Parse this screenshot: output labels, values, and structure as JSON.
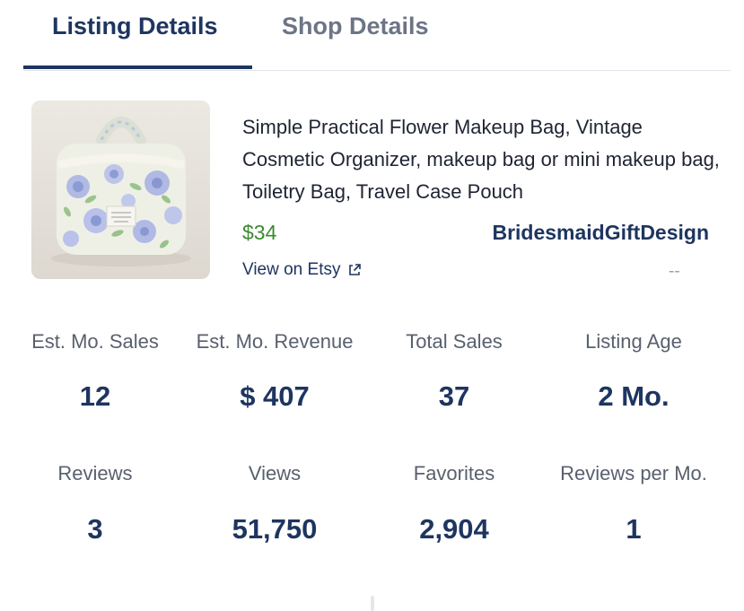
{
  "tabs": [
    {
      "label": "Listing Details",
      "active": true
    },
    {
      "label": "Shop Details",
      "active": false
    }
  ],
  "listing": {
    "title": "Simple Practical Flower Makeup Bag, Vintage Cosmetic Organizer, makeup bag or mini makeup bag, Toiletry Bag, Travel Case Pouch",
    "price": "$34",
    "shop_name": "BridesmaidGiftDesign",
    "view_link": "View on Etsy",
    "extra": "--"
  },
  "stats": [
    {
      "label": "Est. Mo. Sales",
      "value": "12"
    },
    {
      "label": "Est. Mo. Revenue",
      "value": "$ 407"
    },
    {
      "label": "Total Sales",
      "value": "37"
    },
    {
      "label": "Listing Age",
      "value": "2 Mo."
    },
    {
      "label": "Reviews",
      "value": "3"
    },
    {
      "label": "Views",
      "value": "51,750"
    },
    {
      "label": "Favorites",
      "value": "2,904"
    },
    {
      "label": "Reviews per Mo.",
      "value": "1"
    }
  ],
  "colors": {
    "accent": "#1e3560",
    "price": "#3c8a2e",
    "muted": "#6c7486"
  },
  "icons": {
    "external_link": "external-link-icon"
  }
}
